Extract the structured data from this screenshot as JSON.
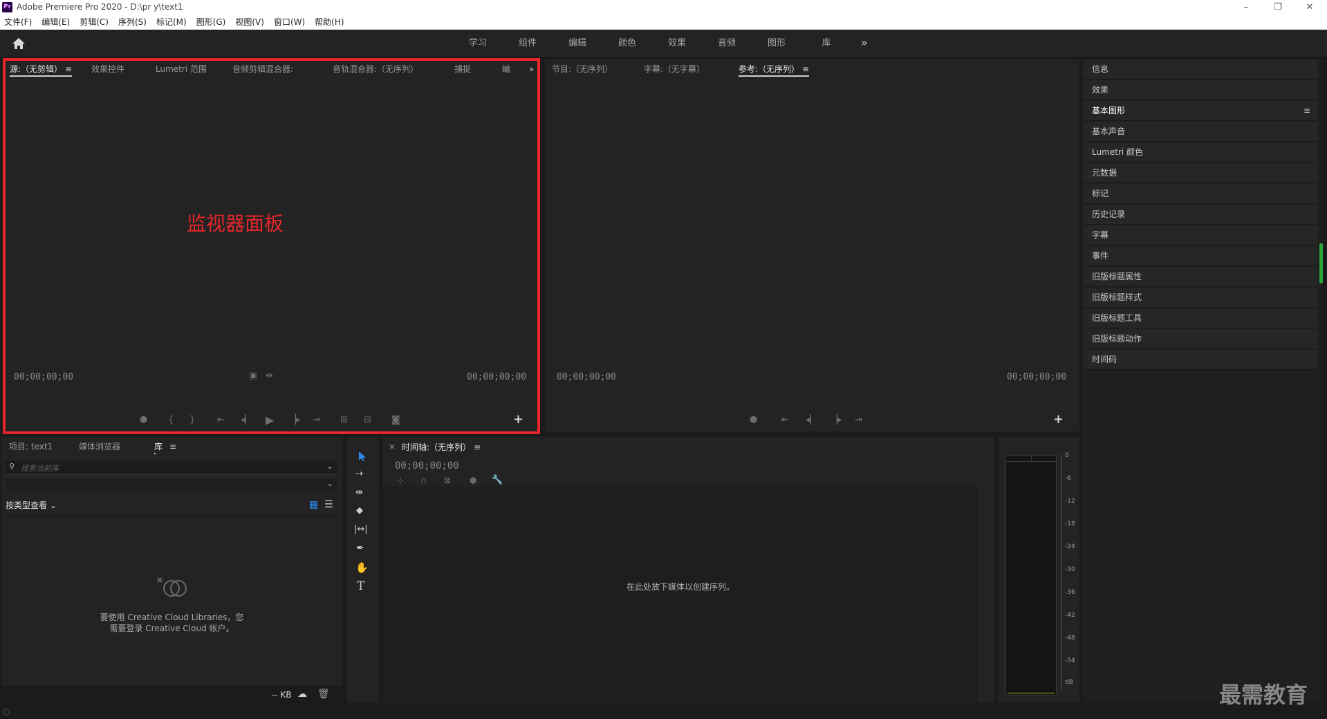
{
  "title_bar": {
    "app_logo": "Pr",
    "title": "Adobe Premiere Pro 2020 - D:\\pr y\\text1",
    "minimize": "–",
    "restore": "❐",
    "close": "✕"
  },
  "menu": [
    "文件(F)",
    "编辑(E)",
    "剪辑(C)",
    "序列(S)",
    "标记(M)",
    "图形(G)",
    "视图(V)",
    "窗口(W)",
    "帮助(H)"
  ],
  "workspaces": [
    "学习",
    "组件",
    "编辑",
    "颜色",
    "效果",
    "音频",
    "图形",
    "库"
  ],
  "workspace_more": "»",
  "source_panel": {
    "tabs": [
      "源:（无剪辑）",
      "效果控件",
      "Lumetri 范围",
      "音频剪辑混合器:",
      "音轨混合器:（无序列）",
      "捕捉",
      "编"
    ],
    "more": "»",
    "timecode_left": "00;00;00;00",
    "timecode_right": "00;00;00;00"
  },
  "program_panel": {
    "tabs": [
      "节目:（无序列）",
      "字幕:（无字幕）",
      "参考:（无序列）"
    ],
    "timecode_left": "00;00;00;00",
    "timecode_right": "00;00;00;00"
  },
  "right_panel": {
    "items": [
      "信息",
      "效果",
      "基本图形",
      "基本声音",
      "Lumetri 颜色",
      "元数据",
      "标记",
      "历史记录",
      "字幕",
      "事件",
      "旧版标题属性",
      "旧版标题样式",
      "旧版标题工具",
      "旧版标题动作",
      "时间码"
    ],
    "active": "基本图形"
  },
  "project_panel": {
    "tabs": [
      "项目: text1",
      "媒体浏览器",
      "库"
    ],
    "search_placeholder": "搜索当前库",
    "view_by": "按类型查看",
    "message_line1": "要使用 Creative Cloud Libraries，您",
    "message_line2": "需要登录 Creative Cloud 帐户。",
    "size_label": "-- KB"
  },
  "timeline_panel": {
    "close": "×",
    "title": "时间轴:（无序列）",
    "timecode": "00;00;00;00",
    "drop_hint": "在此处放下媒体以创建序列。"
  },
  "audio_meter": {
    "scale": [
      "0",
      "-6",
      "-12",
      "-18",
      "-24",
      "-30",
      "-36",
      "-42",
      "-48",
      "-54",
      "dB"
    ]
  },
  "annotation": {
    "label": "监视器面板",
    "color": "#e8262b"
  },
  "watermark": "最需教育",
  "colors": {
    "accent_blue": "#2d8ceb",
    "panel_bg": "#232323",
    "app_bg": "#1b1b1b"
  }
}
